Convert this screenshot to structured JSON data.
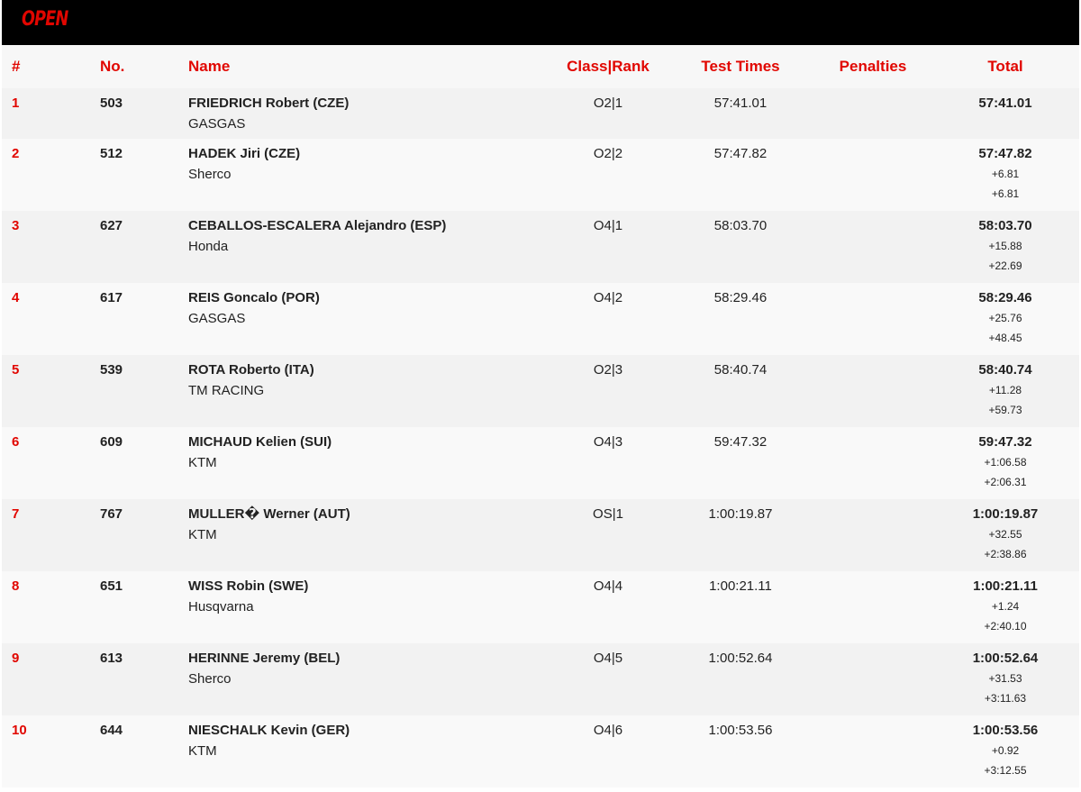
{
  "banner": {
    "title": "OPEN"
  },
  "columns": {
    "pos": "#",
    "no": "No.",
    "name": "Name",
    "class_rank": "Class|Rank",
    "test_times": "Test Times",
    "penalties": "Penalties",
    "total": "Total"
  },
  "rows": [
    {
      "pos": "1",
      "no": "503",
      "rider": "FRIEDRICH Robert (CZE)",
      "team": "GASGAS",
      "class_rank": "O2|1",
      "test_times": "57:41.01",
      "penalties": "",
      "total": "57:41.01",
      "gap_prev": "",
      "gap_first": ""
    },
    {
      "pos": "2",
      "no": "512",
      "rider": "HADEK Jiri (CZE)",
      "team": "Sherco",
      "class_rank": "O2|2",
      "test_times": "57:47.82",
      "penalties": "",
      "total": "57:47.82",
      "gap_prev": "+6.81",
      "gap_first": "+6.81"
    },
    {
      "pos": "3",
      "no": "627",
      "rider": "CEBALLOS-ESCALERA Alejandro (ESP)",
      "team": "Honda",
      "class_rank": "O4|1",
      "test_times": "58:03.70",
      "penalties": "",
      "total": "58:03.70",
      "gap_prev": "+15.88",
      "gap_first": "+22.69"
    },
    {
      "pos": "4",
      "no": "617",
      "rider": "REIS Goncalo (POR)",
      "team": "GASGAS",
      "class_rank": "O4|2",
      "test_times": "58:29.46",
      "penalties": "",
      "total": "58:29.46",
      "gap_prev": "+25.76",
      "gap_first": "+48.45"
    },
    {
      "pos": "5",
      "no": "539",
      "rider": "ROTA Roberto (ITA)",
      "team": "TM RACING",
      "class_rank": "O2|3",
      "test_times": "58:40.74",
      "penalties": "",
      "total": "58:40.74",
      "gap_prev": "+11.28",
      "gap_first": "+59.73"
    },
    {
      "pos": "6",
      "no": "609",
      "rider": "MICHAUD Kelien (SUI)",
      "team": "KTM",
      "class_rank": "O4|3",
      "test_times": "59:47.32",
      "penalties": "",
      "total": "59:47.32",
      "gap_prev": "+1:06.58",
      "gap_first": "+2:06.31"
    },
    {
      "pos": "7",
      "no": "767",
      "rider": "MULLER� Werner (AUT)",
      "team": "KTM",
      "class_rank": "OS|1",
      "test_times": "1:00:19.87",
      "penalties": "",
      "total": "1:00:19.87",
      "gap_prev": "+32.55",
      "gap_first": "+2:38.86"
    },
    {
      "pos": "8",
      "no": "651",
      "rider": "WISS Robin (SWE)",
      "team": "Husqvarna",
      "class_rank": "O4|4",
      "test_times": "1:00:21.11",
      "penalties": "",
      "total": "1:00:21.11",
      "gap_prev": "+1.24",
      "gap_first": "+2:40.10"
    },
    {
      "pos": "9",
      "no": "613",
      "rider": "HERINNE Jeremy (BEL)",
      "team": "Sherco",
      "class_rank": "O4|5",
      "test_times": "1:00:52.64",
      "penalties": "",
      "total": "1:00:52.64",
      "gap_prev": "+31.53",
      "gap_first": "+3:11.63"
    },
    {
      "pos": "10",
      "no": "644",
      "rider": "NIESCHALK Kevin (GER)",
      "team": "KTM",
      "class_rank": "O4|6",
      "test_times": "1:00:53.56",
      "penalties": "",
      "total": "1:00:53.56",
      "gap_prev": "+0.92",
      "gap_first": "+3:12.55"
    }
  ],
  "colors": {
    "accent": "#e10600",
    "banner_bg": "#000000",
    "row_odd": "#f2f2f2",
    "row_even": "#f9f9f9"
  }
}
